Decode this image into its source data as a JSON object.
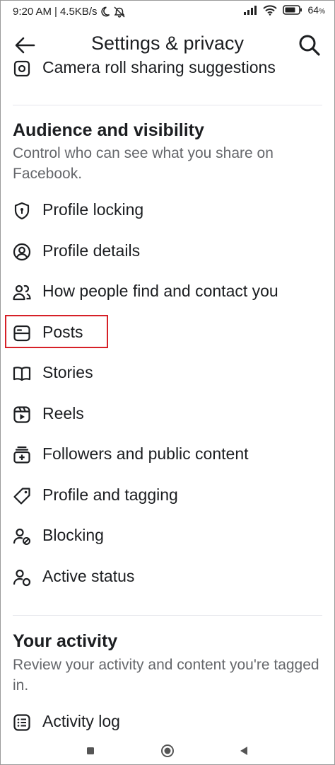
{
  "status_bar": {
    "time": "9:20 AM",
    "separator": "|",
    "speed": "4.5KB/s",
    "battery": "64",
    "battery_unit": "%"
  },
  "header": {
    "title": "Settings & privacy"
  },
  "partial_item": {
    "label": "Camera roll sharing suggestions",
    "icon": "camera-roll-icon"
  },
  "audience": {
    "title": "Audience and visibility",
    "description": "Control who can see what you share on Facebook.",
    "items": [
      {
        "label": "Profile locking",
        "icon": "shield-lock-icon"
      },
      {
        "label": "Profile details",
        "icon": "profile-circle-icon"
      },
      {
        "label": "How people find and contact you",
        "icon": "people-contact-icon"
      },
      {
        "label": "Posts",
        "icon": "posts-icon"
      },
      {
        "label": "Stories",
        "icon": "book-icon"
      },
      {
        "label": "Reels",
        "icon": "reels-icon"
      },
      {
        "label": "Followers and public content",
        "icon": "followers-icon"
      },
      {
        "label": "Profile and tagging",
        "icon": "tag-icon"
      },
      {
        "label": "Blocking",
        "icon": "person-block-icon"
      },
      {
        "label": "Active status",
        "icon": "person-status-icon"
      }
    ]
  },
  "activity": {
    "title": "Your activity",
    "description": "Review your activity and content you're tagged in.",
    "items": [
      {
        "label": "Activity log",
        "icon": "activity-log-icon"
      }
    ]
  },
  "colors": {
    "highlight": "#d62027",
    "text": "#1c1e21",
    "secondary_text": "#65676b",
    "divider": "#e4e6eb"
  }
}
